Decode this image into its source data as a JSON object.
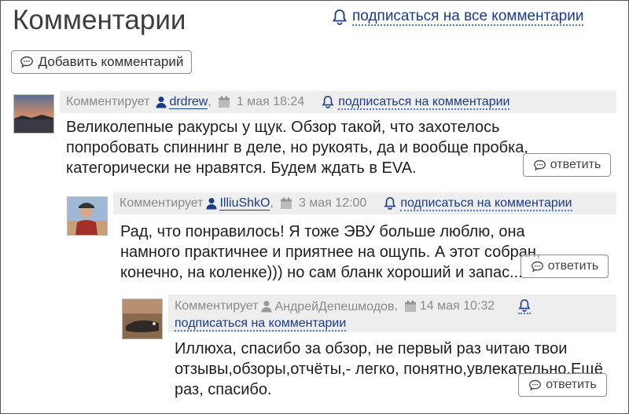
{
  "header": {
    "title": "Комментарии",
    "subscribe_all": "подписаться на все комментарии",
    "add_comment": "Добавить комментарий"
  },
  "comments": [
    {
      "prefix": "Комментирует",
      "author": "drdrew",
      "date": "1 мая 18:24",
      "subscribe": "подписаться на комментарии",
      "text": "Великолепные ракурсы у щук. Обзор такой, что захотелось попробовать спиннинг в деле, но рукоять, да и вообще пробка, категорически не нравятся. Будем ждать в EVA.",
      "reply": "ответить"
    },
    {
      "prefix": "Комментирует",
      "author": "IlliuShkO",
      "date": "3 мая 12:00",
      "subscribe": "подписаться на комментарии",
      "text": "Рад, что понравилось! Я тоже ЭВУ больше люблю, она намного практичнее и приятнее на ощупь. А этот собран, конечно, на коленке))) но сам бланк хороший и запас...",
      "reply": "ответить"
    },
    {
      "prefix": "Комментирует",
      "author": "АндрейДепешмодов",
      "date": "14 мая 10:32",
      "subscribe": "подписаться на комментарии",
      "text": "Иллюха, спасибо за обзор, не первый раз читаю твои отзывы,обзоры,отчёты,- легко, понятно,увлекательно.Ещё раз, спасибо.",
      "reply": "ответить"
    }
  ],
  "colors": {
    "link": "#1a3b8a",
    "muted": "#8a8a8a",
    "header_bg": "#eeeeee"
  }
}
